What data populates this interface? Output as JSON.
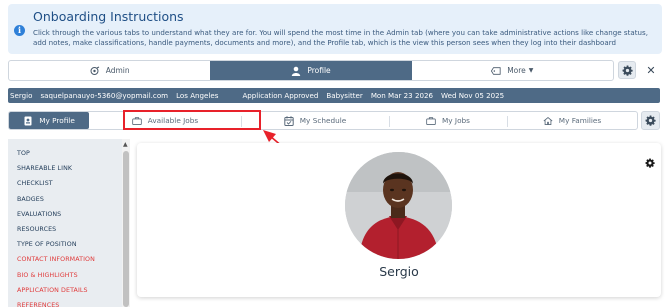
{
  "banner": {
    "title": "Onboarding Instructions",
    "body": "Click through the various tabs to understand what they are for. You will spend the most time in the Admin tab (where you can take administrative actions like change status, add notes, make classifications, handle payments, documents and more), and the Profile tab, which is the view this person sees when they log into their dashboard"
  },
  "top_tabs": [
    {
      "label": "Admin",
      "icon": "admin-icon",
      "active": false
    },
    {
      "label": "Profile",
      "icon": "user-icon",
      "active": true
    },
    {
      "label": "More",
      "icon": "tag-icon",
      "active": false
    }
  ],
  "info_bar": {
    "name": "Sergio",
    "email": "saquelpanauyo-5360@yopmail.com",
    "location": "Los Angeles",
    "status": "Application Approved",
    "role": "Babysitter",
    "date1": "Mon Mar 23 2026",
    "date2": "Wed Nov 05 2025"
  },
  "sub_tabs": [
    {
      "label": "My Profile",
      "icon": "profile-card-icon",
      "active": true
    },
    {
      "label": "Available Jobs",
      "icon": "briefcase-icon",
      "active": false
    },
    {
      "label": "My Schedule",
      "icon": "calendar-icon",
      "active": false
    },
    {
      "label": "My Jobs",
      "icon": "briefcase-icon",
      "active": false
    },
    {
      "label": "My Families",
      "icon": "house-icon",
      "active": false
    }
  ],
  "sidebar": {
    "items": [
      {
        "label": "TOP",
        "color": "#1f3a57"
      },
      {
        "label": "SHAREABLE LINK",
        "color": "#1f3a57"
      },
      {
        "label": "CHECKLIST",
        "color": "#1f3a57"
      },
      {
        "label": "BADGES",
        "color": "#1f3a57"
      },
      {
        "label": "EVALUATIONS",
        "color": "#1f3a57"
      },
      {
        "label": "RESOURCES",
        "color": "#1f3a57"
      },
      {
        "label": "TYPE OF POSITION",
        "color": "#1f3a57"
      },
      {
        "label": "CONTACT INFORMATION",
        "color": "#e03a3a"
      },
      {
        "label": "BIO & HIGHLIGHTS",
        "color": "#e03a3a"
      },
      {
        "label": "APPLICATION DETAILS",
        "color": "#e03a3a"
      },
      {
        "label": "REFERENCES",
        "color": "#e03a3a"
      }
    ]
  },
  "profile": {
    "name": "Sergio"
  },
  "colors": {
    "primary": "#4e6a86",
    "banner_bg": "#e6f0fa",
    "highlight": "#e8212a",
    "alert_text": "#e03a3a"
  }
}
